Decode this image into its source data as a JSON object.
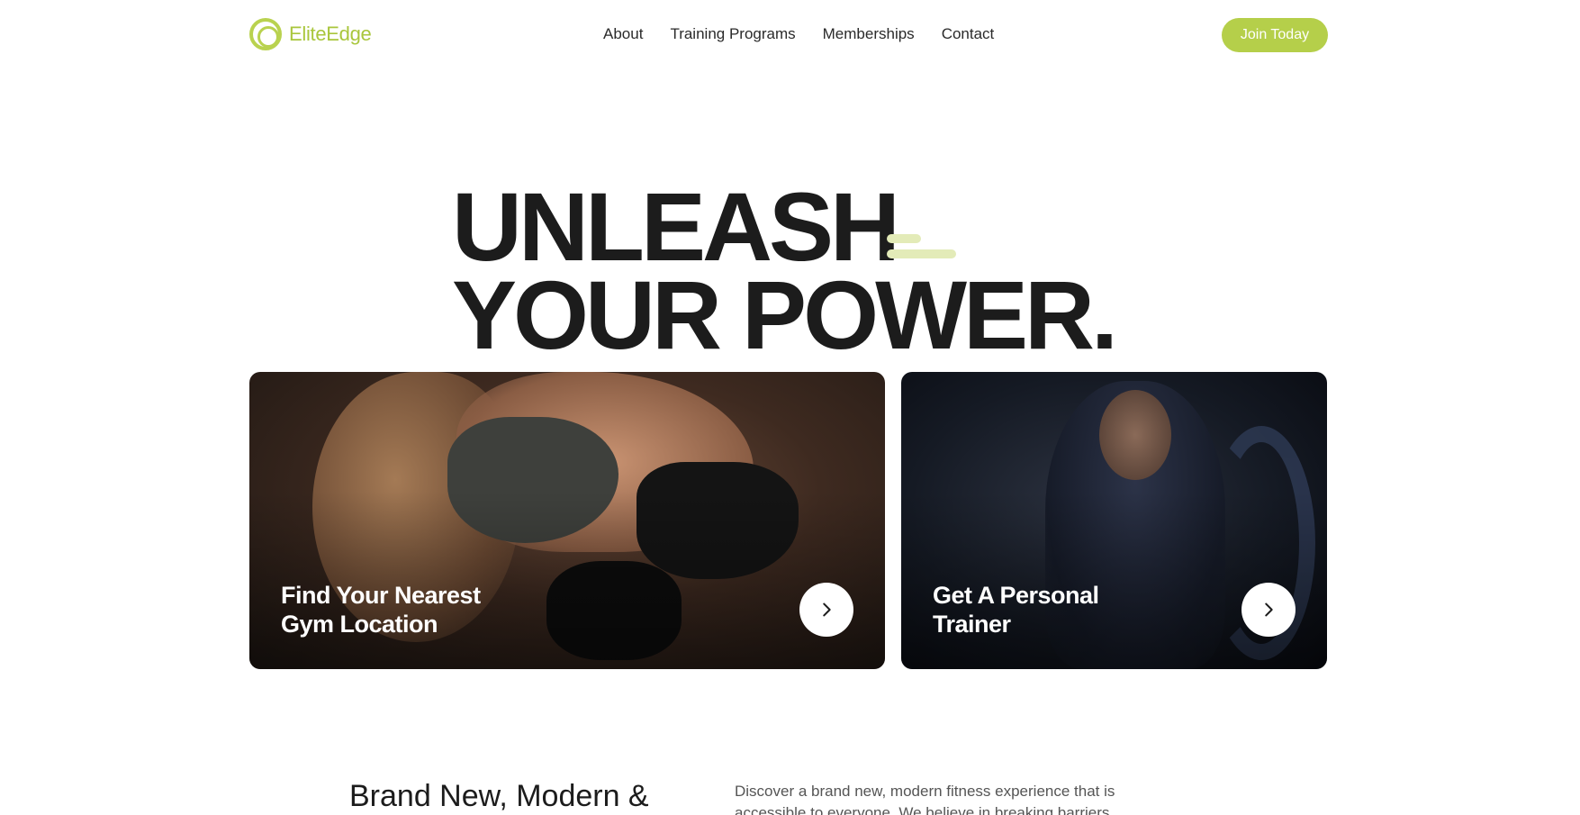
{
  "brand": {
    "name": "EliteEdge",
    "accent_color": "#b5cf4a",
    "logo_icon": "ring-logo-icon"
  },
  "nav": {
    "links": [
      {
        "label": "About"
      },
      {
        "label": "Training Programs"
      },
      {
        "label": "Memberships"
      },
      {
        "label": "Contact"
      }
    ],
    "cta_label": "Join Today"
  },
  "hero": {
    "line_1": "UNLEASH",
    "line_2": "YOUR POWER."
  },
  "cards": [
    {
      "title": "Find Your Nearest\nGym Location",
      "arrow_icon": "chevron-right-icon"
    },
    {
      "title": "Get A Personal\nTrainer",
      "arrow_icon": "chevron-right-icon"
    }
  ],
  "intro": {
    "heading": "Brand New, Modern &",
    "description": "Discover a brand new, modern fitness experience that is accessible to everyone. We believe in breaking barriers"
  }
}
